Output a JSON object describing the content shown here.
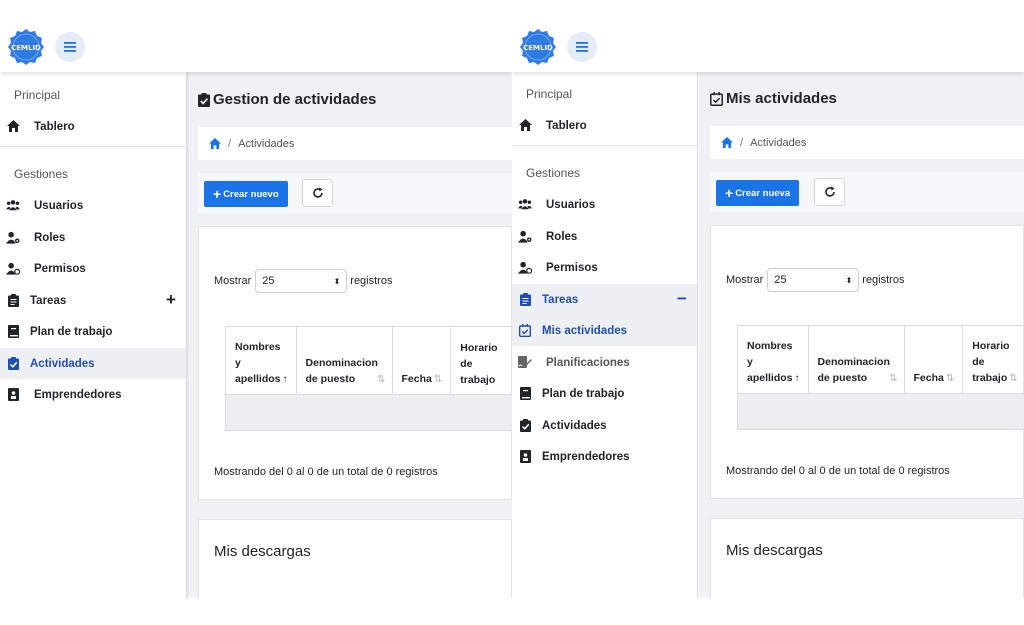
{
  "colors": {
    "primary": "#1a73e8",
    "logo": "#2f7be6",
    "sidebar_active_text": "#1f4fb5"
  },
  "left": {
    "logo_text": "CEMLID",
    "sidebar": {
      "section_principal": "Principal",
      "tablero": "Tablero",
      "section_gestiones": "Gestiones",
      "usuarios": "Usuarios",
      "roles": "Roles",
      "permisos": "Permisos",
      "tareas": "Tareas",
      "tareas_toggle": "+",
      "plan_de_trabajo": "Plan de trabajo",
      "actividades": "Actividades",
      "emprendedores": "Emprendedores"
    },
    "page_title": "Gestion de actividades",
    "breadcrumb": {
      "separator": "/",
      "current": "Actividades"
    },
    "toolbar": {
      "create_label": "Crear nuevo"
    },
    "table": {
      "show_label": "Mostrar",
      "page_size": "25",
      "records_label": "registros",
      "headers": [
        {
          "lines": [
            "Nombres",
            "y",
            "apellidos"
          ],
          "sort": "↑"
        },
        {
          "lines": [
            "Denominacion",
            "de puesto"
          ],
          "sort": "⇅"
        },
        {
          "lines": [
            "Fecha"
          ],
          "sort": "⇅"
        },
        {
          "lines": [
            "Horario",
            "de",
            "trabajo"
          ],
          "sort": ""
        }
      ],
      "showing": "Mostrando del 0 al 0 de un total de 0 registros"
    },
    "downloads_title": "Mis descargas"
  },
  "right": {
    "logo_text": "CEMLID",
    "sidebar": {
      "section_principal": "Principal",
      "tablero": "Tablero",
      "section_gestiones": "Gestiones",
      "usuarios": "Usuarios",
      "roles": "Roles",
      "permisos": "Permisos",
      "tareas": "Tareas",
      "tareas_toggle": "−",
      "mis_actividades": "Mis actividades",
      "planificaciones": "Planificaciones",
      "plan_de_trabajo": "Plan de trabajo",
      "actividades": "Actividades",
      "emprendedores": "Emprendedores"
    },
    "page_title": "Mis actividades",
    "breadcrumb": {
      "separator": "/",
      "current": "Actividades"
    },
    "toolbar": {
      "create_label": "Crear nueva"
    },
    "table": {
      "show_label": "Mostrar",
      "page_size": "25",
      "records_label": "registros",
      "headers": [
        {
          "lines": [
            "Nombres",
            "y",
            "apellidos"
          ],
          "sort": "↑"
        },
        {
          "lines": [
            "Denominacion",
            "de puesto"
          ],
          "sort": "⇅"
        },
        {
          "lines": [
            "Fecha"
          ],
          "sort": "⇅"
        },
        {
          "lines": [
            "Horario",
            "de",
            "trabajo"
          ],
          "sort": "⇅"
        }
      ],
      "showing": "Mostrando del 0 al 0 de un total de 0 registros"
    },
    "downloads_title": "Mis descargas"
  }
}
